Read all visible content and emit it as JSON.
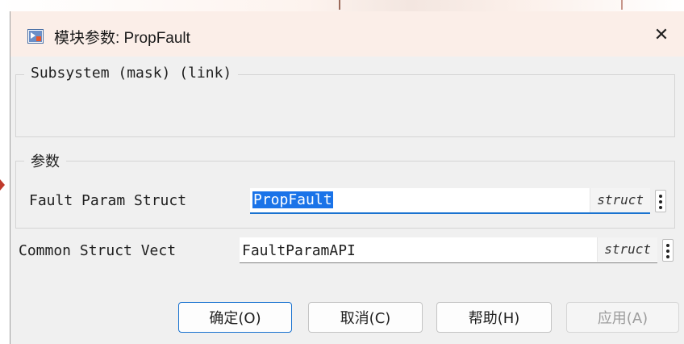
{
  "window": {
    "title": "模块参数: PropFault",
    "close_glyph": "✕"
  },
  "groups": {
    "subsystem": {
      "legend": "Subsystem (mask) (link)"
    },
    "parameters": {
      "legend": "参数",
      "fields": [
        {
          "label": "Fault Param Struct",
          "value": "PropFault",
          "type": "struct",
          "selected": true
        }
      ]
    }
  },
  "extra_fields": [
    {
      "label": "Common Struct Vect",
      "value": "FaultParamAPI",
      "type": "struct"
    }
  ],
  "buttons": {
    "ok": "确定(O)",
    "cancel": "取消(C)",
    "help": "帮助(H)",
    "apply": "应用(A)"
  },
  "icons": {
    "title_icon": "simulink-block-icon",
    "close_icon": "close-icon",
    "menu_icon": "kebab-menu-icon"
  },
  "colors": {
    "titlebar": "#fbeee8",
    "dialog_bg": "#f0f0f0",
    "selection": "#1a73e8",
    "focus_accent": "#1a73d0"
  }
}
